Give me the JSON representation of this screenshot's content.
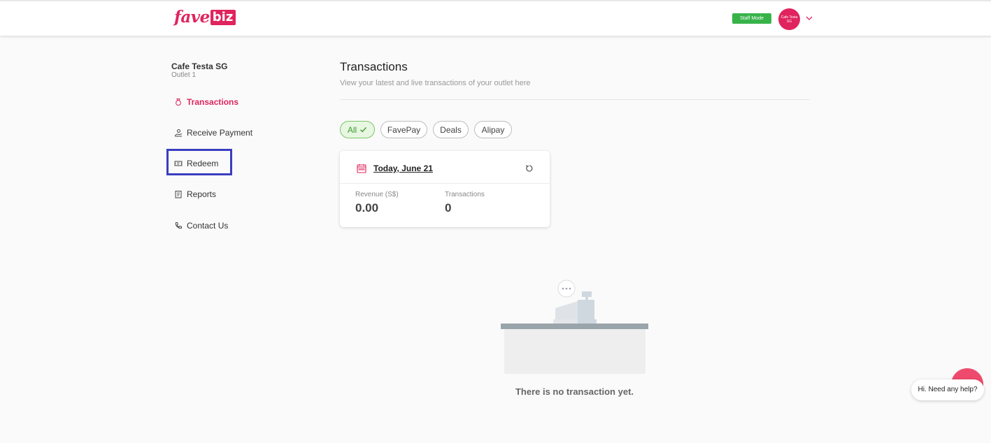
{
  "brand": {
    "logo_fave": "fave",
    "logo_biz": "biz",
    "accent": "#e0245e"
  },
  "header": {
    "staff_mode_label": "Staff Mode",
    "avatar_text": "Cafe Testa SG"
  },
  "outlet": {
    "name": "Cafe Testa SG",
    "sub": "Outlet 1"
  },
  "sidebar": {
    "items": [
      {
        "label": "Transactions",
        "icon": "moneybag-icon",
        "active": true
      },
      {
        "label": "Receive Payment",
        "icon": "hand-coin-icon",
        "active": false
      },
      {
        "label": "Redeem",
        "icon": "ticket-icon",
        "active": false,
        "highlighted": true
      },
      {
        "label": "Reports",
        "icon": "clipboard-icon",
        "active": false
      },
      {
        "label": "Contact Us",
        "icon": "phone-icon",
        "active": false
      }
    ]
  },
  "main": {
    "title": "Transactions",
    "subtitle": "View your latest and live transactions of your outlet here",
    "filters": [
      {
        "label": "All",
        "selected": true
      },
      {
        "label": "FavePay",
        "selected": false
      },
      {
        "label": "Deals",
        "selected": false
      },
      {
        "label": "Alipay",
        "selected": false
      }
    ],
    "card": {
      "date_label": "Today, June 21",
      "revenue_label": "Revenue (S$)",
      "revenue_value": "0.00",
      "transactions_label": "Transactions",
      "transactions_value": "0"
    },
    "empty_state": "There is no transaction yet."
  },
  "help": {
    "bubble_text": "Hi. Need any help?",
    "color": "#ee4a6d"
  },
  "colors": {
    "staff_mode": "#37b34a",
    "filter_selected": "#3e9a2c",
    "highlight_border": "#3a3dbf"
  }
}
